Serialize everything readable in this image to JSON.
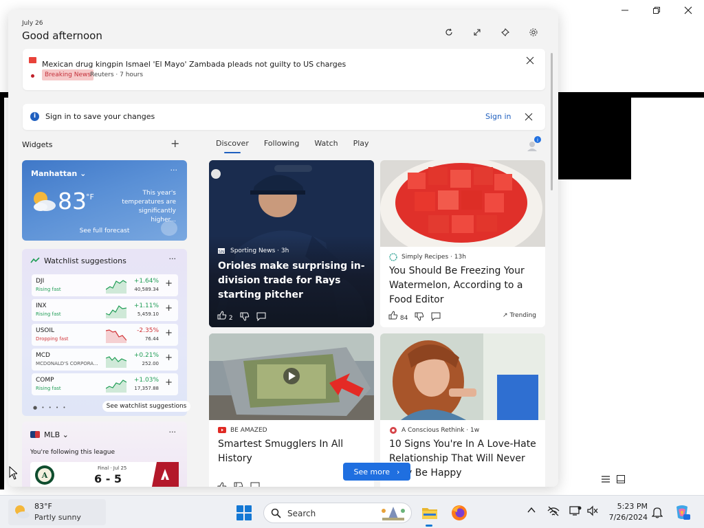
{
  "header": {
    "date": "July 26",
    "greeting": "Good afternoon"
  },
  "breaking": {
    "headline": "Mexican drug kingpin Ismael 'El Mayo' Zambada pleads not guilty to US charges",
    "tag": "Breaking News",
    "source": "Reuters · 7 hours"
  },
  "signin_bar": {
    "message": "Sign in to save your changes",
    "link": "Sign in"
  },
  "widgets_label": "Widgets",
  "tabs": [
    "Discover",
    "Following",
    "Watch",
    "Play"
  ],
  "weather": {
    "city": "Manhattan",
    "temp": "83",
    "unit": "°F",
    "message": "This year's temperatures are significantly higher...",
    "forecast_link": "See full forecast"
  },
  "watchlist": {
    "title": "Watchlist suggestions",
    "rows": [
      {
        "symbol": "DJI",
        "status": "Rising fast",
        "change": "+1.64%",
        "price": "40,589.34",
        "direction": "up"
      },
      {
        "symbol": "INX",
        "status": "Rising fast",
        "change": "+1.11%",
        "price": "5,459.10",
        "direction": "up"
      },
      {
        "symbol": "USOIL",
        "status": "Dropping fast",
        "change": "-2.35%",
        "price": "76.44",
        "direction": "down"
      },
      {
        "symbol": "MCD",
        "status": "MCDONALD'S CORPORA...",
        "change": "+0.21%",
        "price": "252.00",
        "direction": "up"
      },
      {
        "symbol": "COMP",
        "status": "Rising fast",
        "change": "+1.03%",
        "price": "17,357.88",
        "direction": "up"
      }
    ],
    "see_more": "See watchlist suggestions"
  },
  "mlb": {
    "title": "MLB",
    "following": "You're following this league",
    "final": "Final · Jul 25",
    "score": "6 - 5"
  },
  "news": [
    {
      "source": "Sporting News · 3h",
      "headline": "Orioles make surprising in-division trade for Rays starting pitcher",
      "likes": "2"
    },
    {
      "source": "Simply Recipes · 13h",
      "headline": "You Should Be Freezing Your Watermelon, According to a Food Editor",
      "likes": "84",
      "trending": "Trending"
    },
    {
      "source": "BE AMAZED",
      "headline": "Smartest Smugglers In All History"
    },
    {
      "source": "A Conscious Rethink · 1w",
      "headline": "10 Signs You're In A Love-Hate Relationship That Will Never Truly Be Happy"
    }
  ],
  "see_more_button": "See more",
  "taskbar": {
    "weather_temp": "83°F",
    "weather_desc": "Partly sunny",
    "search_label": "Search",
    "time": "5:23 PM",
    "date": "7/26/2024"
  },
  "colors": {
    "accent": "#1f6fe0",
    "up": "#1f9d55",
    "down": "#d13438",
    "breaking": "#c4313b"
  }
}
